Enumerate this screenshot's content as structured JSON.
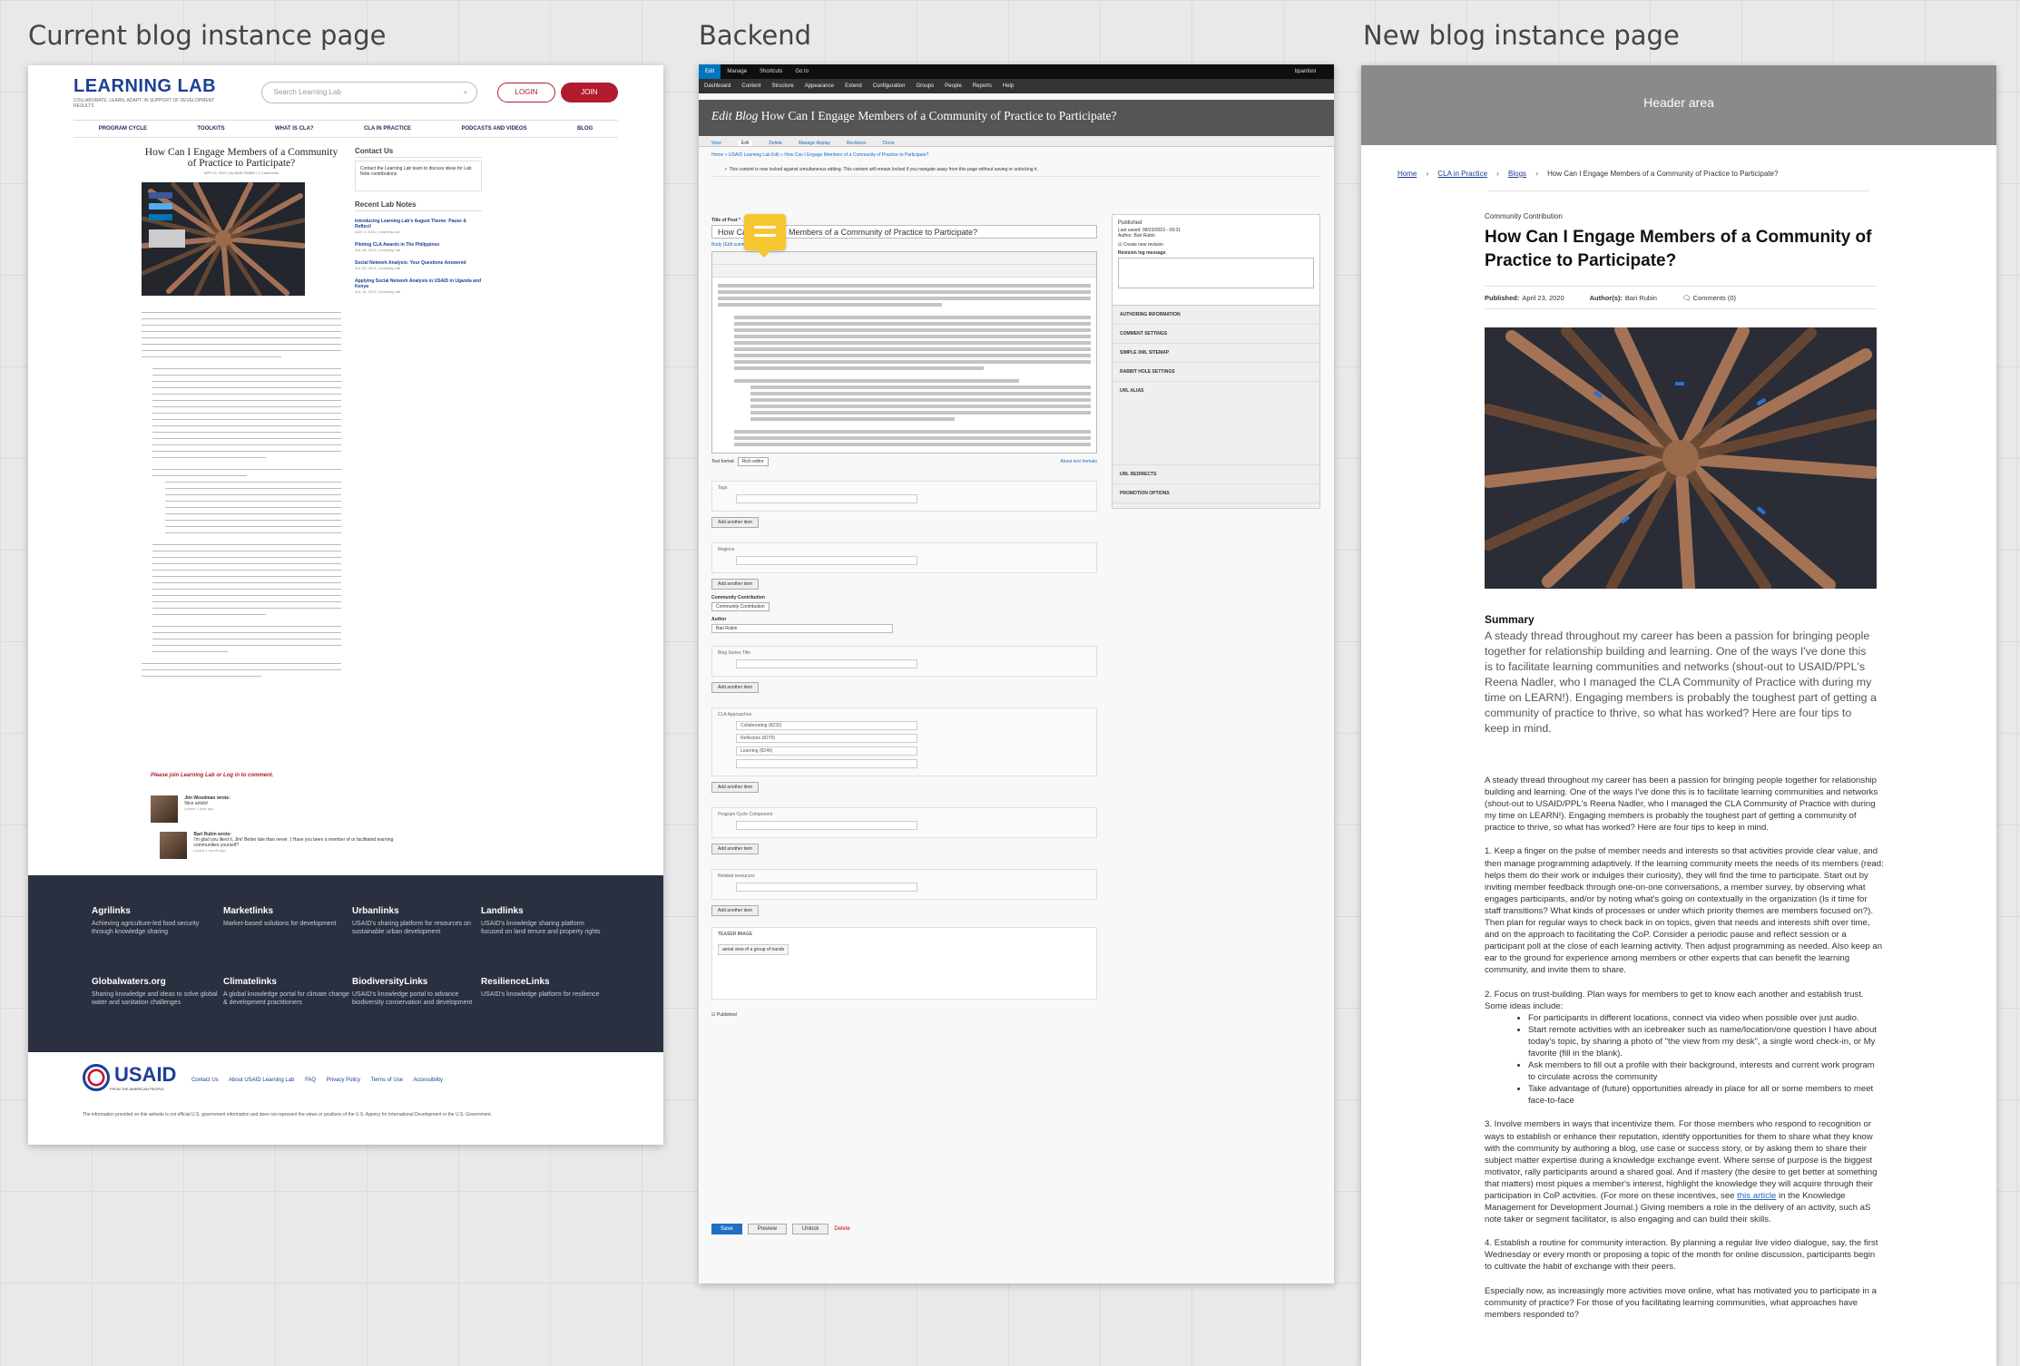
{
  "columns": {
    "current": "Current blog instance page",
    "backend": "Backend",
    "new": "New blog instance page"
  },
  "current_page": {
    "logo": "LEARNING LAB",
    "tagline": "COLLABORATE. LEARN. ADAPT. IN SUPPORT OF DEVELOPMENT RESULTS",
    "search_placeholder": "Search Learning Lab",
    "login_label": "LOGIN",
    "join_label": "JOIN",
    "nav": [
      "PROGRAM CYCLE",
      "TOOLKITS",
      "WHAT IS CLA?",
      "CLA IN PRACTICE",
      "PODCASTS AND VIDEOS",
      "BLOG"
    ],
    "article_title": "How Can I Engage Members of a Community of Practice to Participate?",
    "article_meta": "APR 23, 2020 | by BARI RUBIN | 0 Comments",
    "side_contact_heading": "Contact Us",
    "side_contact_text": "Contact the Learning Lab team to discuss ideas for Lab Note contributions",
    "recent_heading": "Recent Lab Notes",
    "recent": [
      {
        "title": "Introducing Learning Lab's August Theme: Pause & Reflect!",
        "meta": "AUG 4, 2021 | Learning Lab"
      },
      {
        "title": "Piloting CLA Awards in The Philippines",
        "meta": "JUL 28, 2021 | Learning Lab"
      },
      {
        "title": "Social Network Analysis: Your Questions Answered",
        "meta": "JUL 22, 2021 | Learning Lab"
      },
      {
        "title": "Applying Social Network Analysis in USAID in Uganda and Kenya",
        "meta": "JUL 16, 2021 | Learning Lab"
      }
    ],
    "login_prompt": "Please join Learning Lab or Log in to comment.",
    "comments": [
      {
        "author": "Jim Woodman wrote:",
        "text": "Nice article!",
        "meta": "posted 1 year ago"
      },
      {
        "author": "Bari Rubin wrote:",
        "text": "I'm glad you liked it, Jim! Better late than never :) Have you been a member of or facilitated learning communities yourself?",
        "meta": "posted 1 month ago"
      }
    ],
    "footer_sites": [
      {
        "name": "Agrilinks",
        "desc": "Achieving agriculture-led food security through knowledge sharing"
      },
      {
        "name": "Marketlinks",
        "desc": "Market-based solutions for development"
      },
      {
        "name": "Urbanlinks",
        "desc": "USAID's sharing platform for resources on sustainable urban development"
      },
      {
        "name": "Landlinks",
        "desc": "USAID's knowledge sharing platform focused on land tenure and property rights"
      },
      {
        "name": "Globalwaters.org",
        "desc": "Sharing knowledge and ideas to solve global water and sanitation challenges"
      },
      {
        "name": "Climatelinks",
        "desc": "A global knowledge portal for climate change & development practitioners"
      },
      {
        "name": "BiodiversityLinks",
        "desc": "USAID's knowledge portal to advance biodiversity conservation and development"
      },
      {
        "name": "ResilienceLinks",
        "desc": "USAID's knowledge platform for resilience"
      }
    ],
    "usaid_word": "USAID",
    "usaid_sub": "FROM THE AMERICAN PEOPLE",
    "footer_links": [
      "Contact Us",
      "About USAID Learning Lab",
      "FAQ",
      "Privacy Policy",
      "Terms of Use",
      "Accessibility"
    ],
    "footer_note": "The information provided on this website is not official U.S. government information and does not represent the views or positions of the U.S. Agency for International Development or the U.S. Government."
  },
  "backend": {
    "toolbar1": [
      "Edit",
      "Manage",
      "Shortcuts",
      "Go to"
    ],
    "user": "bpantoni",
    "toolbar2": [
      "Dashboard",
      "Content",
      "Structure",
      "Appearance",
      "Extend",
      "Configuration",
      "Groups",
      "People",
      "Reports",
      "Help"
    ],
    "page_title_prefix": "Edit Blog",
    "page_title": "How Can I Engage Members of a Community of Practice to Participate?",
    "tabs": [
      "View",
      "Edit",
      "Delete",
      "Manage display",
      "Revisions",
      "Clone"
    ],
    "breadcrumb": "Home » USAID Learning Lab Edit » How Can I Engage Members of a Community of Practice to Participate?",
    "message": "This content is now locked against simultaneous editing. This content will remain locked if you navigate away from this page without saving or unlocking it.",
    "title_label": "Title of Post *",
    "title_value": "How Can I Engage Members of a Community of Practice to Participate?",
    "body_label": "Body (Edit summary)",
    "text_format_label": "Text format",
    "text_format_value": "Rich editor",
    "about_formats": "About text formats",
    "fields": [
      {
        "label": "Tags",
        "rows": [
          ""
        ],
        "button": "Add another item"
      },
      {
        "label": "Regions",
        "rows": [
          ""
        ],
        "button": "Add another item"
      },
      {
        "label": "Blog Series Title",
        "rows": [
          ""
        ],
        "button": "Add another item"
      },
      {
        "label": "CLA Approaches",
        "rows": [
          "Collaborating (8232)",
          "Reflection (8270)",
          "Learning (8246)",
          ""
        ],
        "button": "Add another item"
      },
      {
        "label": "Program Cycle Component",
        "rows": [
          ""
        ],
        "button": "Add another item"
      },
      {
        "label": "Related resources",
        "rows": [
          ""
        ],
        "button": "Add another item"
      }
    ],
    "community_label": "Community Contribution",
    "community_value": "Community Contribution",
    "author_label": "Author",
    "author_value": "Bari Rubin",
    "teaser_label": "TEASER IMAGE",
    "teaser_value": "aerial view of a group of hands",
    "published_label": "Published",
    "sidebar_published": "Published",
    "sidebar_last_saved": "Last saved: 08/23/2023 - 09:31",
    "sidebar_author": "Author: Bari Rubin",
    "sidebar_new_revision": "Create new revision",
    "sidebar_revision_log": "Revision log message",
    "sidebar_sections": [
      "AUTHORING INFORMATION",
      "COMMENT SETTINGS",
      "SIMPLE XML SITEMAP",
      "RABBIT HOLE SETTINGS",
      "URL ALIAS",
      "URL REDIRECTS",
      "PROMOTION OPTIONS"
    ],
    "save": "Save",
    "preview": "Preview",
    "unlock": "Unlock",
    "delete": "Delete"
  },
  "new_page": {
    "header": "Header area",
    "breadcrumb": [
      "Home",
      "CLA in Practice",
      "Blogs",
      "How Can I Engage Members of a Community of Practice to Participate?"
    ],
    "category": "Community Contribution",
    "title": "How Can I Engage Members of a Community of Practice to Participate?",
    "published_label": "Published:",
    "published_value": "April 23, 2020",
    "authors_label": "Author(s):",
    "authors_value": "Bari Rubin",
    "comments": "Comments (0)",
    "summary_heading": "Summary",
    "summary": "A steady thread throughout my career has been a passion for bringing people together for relationship building and learning. One of the ways I've done this is to facilitate learning communities and networks (shout-out to USAID/PPL's Reena Nadler, who I managed the CLA Community of Practice with during my time on LEARN!). Engaging members is probably the toughest part of getting a community of practice to thrive, so what has worked? Here are four tips to keep in mind.",
    "intro": "A steady thread throughout my career has been a passion for bringing people together for relationship building and learning. One of the ways I've done this is to facilitate learning communities and networks (shout-out to USAID/PPL's Reena Nadler, who I managed the CLA Community of Practice with during my time on LEARN!). Engaging members is probably the toughest part of getting a community of practice to thrive, so what has worked? Here are four tips to keep in mind.",
    "tip1": "1. Keep a finger on the pulse of member needs and interests so that activities provide clear value, and then manage programming adaptively. If the learning community meets the needs of its members (read: helps them do their work or indulges their curiosity), they will find the time to participate. Start out by inviting member feedback through one-on-one conversations, a member survey, by observing what engages participants, and/or by noting what's going on contextually in the organization (Is it time for staff transitions? What kinds of processes or under which priority themes are members focused on?). Then plan for regular ways to check back in on topics, given that needs and interests shift over time, and on the approach to facilitating the CoP. Consider a periodic pause and reflect session or a participant poll at the close of each learning activity. Then adjust programming as needed. Also keep an ear to the ground for experience among members or other experts that can benefit the learning community, and invite them to share.",
    "tip2": "2. Focus on trust-building. Plan ways for members to get to know each another and establish trust. Some ideas include:",
    "tip2_items": [
      "For participants in different locations, connect via video when possible over just audio.",
      "Start remote activities with an icebreaker such as name/location/one question I have about today's topic, by sharing a photo of \"the view from my desk\", a single word check-in, or My favorite (fill in the blank).",
      "Ask members to fill out a profile with their background, interests and current work program to circulate across the community",
      "Take advantage of (future) opportunities already in place for all or some members to meet face-to-face"
    ],
    "tip3_before": "3. Involve members in ways that incentivize them. For those members who respond to recognition or ways to establish or enhance their reputation, identify opportunities for them to share what they know with the community by authoring a blog, use case or success story, or by asking them to share their subject matter expertise during a knowledge exchange event. Where sense of purpose is the biggest motivator, rally participants around a shared goal. And if mastery (the desire to get better at something that matters) most piques a member's interest, highlight the knowledge they will acquire through their participation in CoP activities. (For more on these incentives, see ",
    "tip3_link": "this article",
    "tip3_after": " in the Knowledge Management for Development Journal.) Giving members a role in the delivery of an activity, such aS note taker or segment facilitator, is also engaging and can build their skills.",
    "tip4": "4. Establish a routine for community interaction. By planning a regular live video dialogue, say, the first Wednesday or every month or proposing a topic of the month for online discussion, participants begin to cultivate the habit of exchange with their peers.",
    "closing": "Especially now, as increasingly more activities move online, what has motivated you to participate in a community of practice? For those of you facilitating learning communities, what approaches have members responded to?"
  }
}
